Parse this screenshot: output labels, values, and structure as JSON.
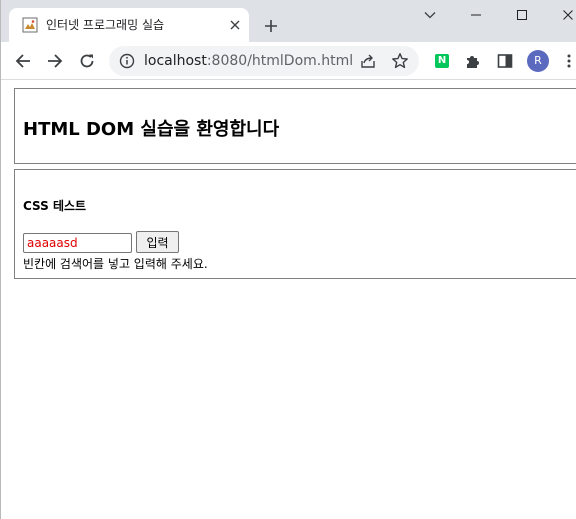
{
  "browser": {
    "tab_title": "인터넷 프로그래밍 실습",
    "url_host": "localhost",
    "url_rest": ":8080/htmlDom.html",
    "profile_initial": "R",
    "extension_badge": "N",
    "colors": {
      "tabstrip": "#dee1e6",
      "omnibox": "#f1f3f4",
      "avatar": "#5b6abf",
      "extension": "#03c75a"
    },
    "icons": [
      "favicon-icon",
      "close-icon",
      "plus-icon",
      "chevron-down-icon",
      "minimize-icon",
      "maximize-icon",
      "window-close-icon",
      "back-icon",
      "forward-icon",
      "reload-icon",
      "info-icon",
      "share-icon",
      "star-icon",
      "puzzle-icon",
      "side-panel-icon",
      "kebab-menu-icon"
    ]
  },
  "page": {
    "heading": "HTML DOM 실습을 환영합니다",
    "section_heading": "CSS 테스트",
    "input_value": "aaaaasd",
    "input_text_color": "#e00000",
    "button_label": "입력",
    "hint": "빈칸에 검색어를 넣고 입력해 주세요."
  }
}
